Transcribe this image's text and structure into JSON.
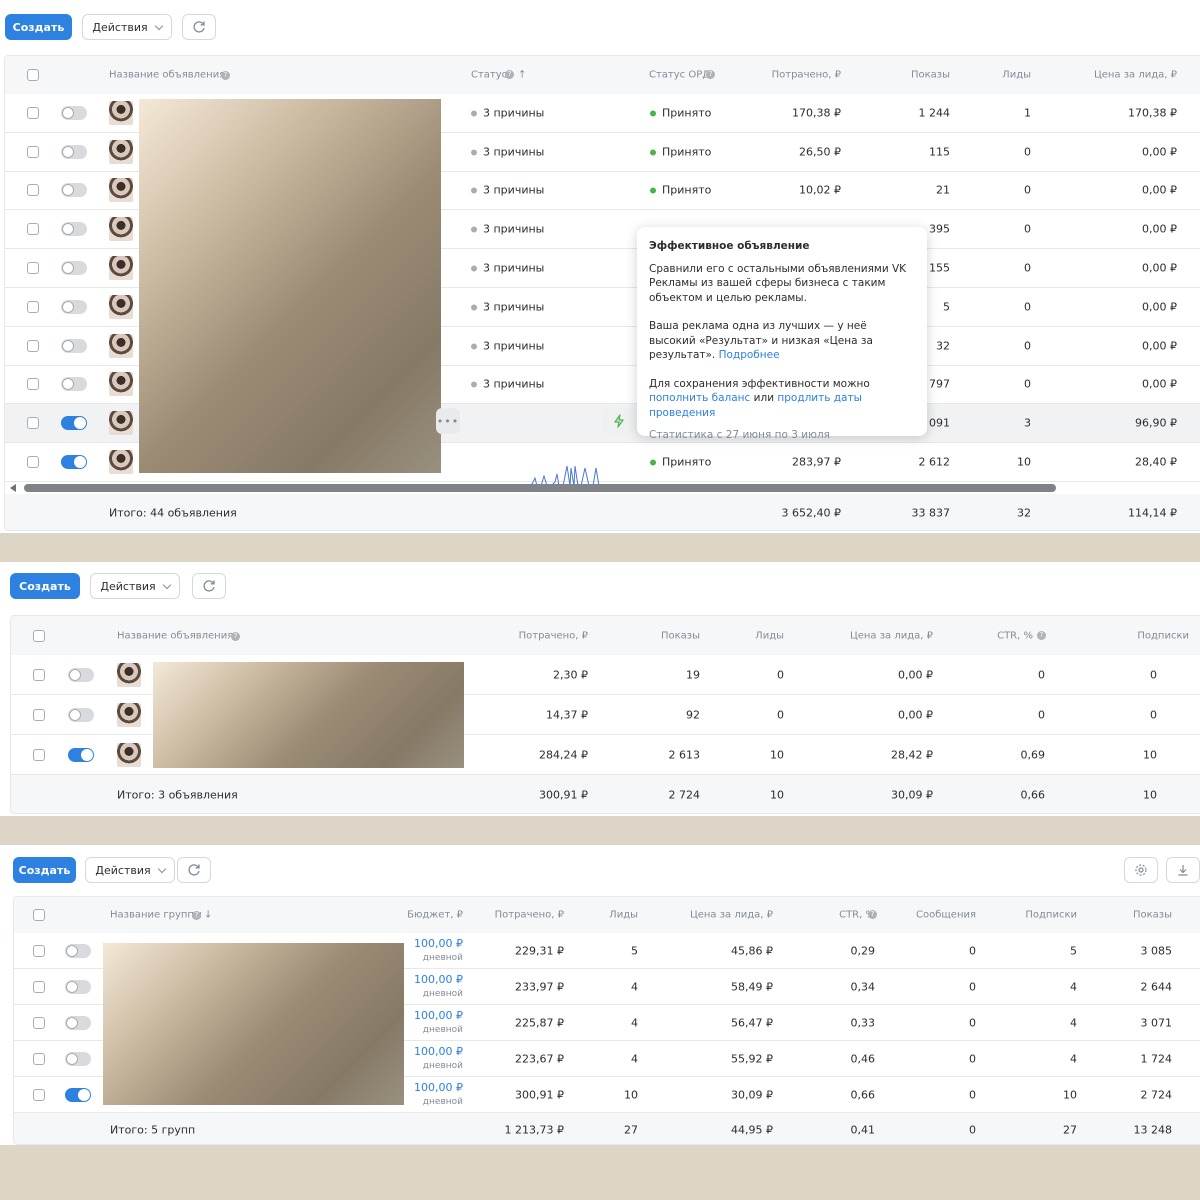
{
  "toolbar": {
    "create_label": "Создать",
    "actions_label": "Действия"
  },
  "panel1": {
    "headers": {
      "name": "Название объявления",
      "status": "Статус",
      "ord_status": "Статус ОРД",
      "spent": "Потрачено, ₽",
      "shows": "Показы",
      "leads": "Лиды",
      "lead_price": "Цена за лида, ₽"
    },
    "rows": [
      {
        "status": "3 причины",
        "ord": "Принято",
        "spent": "170,38 ₽",
        "shows": "1 244",
        "leads": "1",
        "price": "170,38 ₽",
        "on": false
      },
      {
        "status": "3 причины",
        "ord": "Принято",
        "spent": "26,50 ₽",
        "shows": "115",
        "leads": "0",
        "price": "0,00 ₽",
        "on": false
      },
      {
        "status": "3 причины",
        "ord": "Принято",
        "spent": "10,02 ₽",
        "shows": "21",
        "leads": "0",
        "price": "0,00 ₽",
        "on": false
      },
      {
        "status": "3 причины",
        "ord": "",
        "spent": "",
        "shows": "395",
        "leads": "0",
        "price": "0,00 ₽",
        "on": false
      },
      {
        "status": "3 причины",
        "ord": "",
        "spent": "",
        "shows": "155",
        "leads": "0",
        "price": "0,00 ₽",
        "on": false
      },
      {
        "status": "3 причины",
        "ord": "",
        "spent": "",
        "shows": "5",
        "leads": "0",
        "price": "0,00 ₽",
        "on": false
      },
      {
        "status": "3 причины",
        "ord": "",
        "spent": "",
        "shows": "32",
        "leads": "0",
        "price": "0,00 ₽",
        "on": false
      },
      {
        "status": "3 причины",
        "ord": "",
        "spent": "",
        "shows": "797",
        "leads": "0",
        "price": "0,00 ₽",
        "on": false
      },
      {
        "status": "",
        "ord": "",
        "spent": "",
        "shows": "2 091",
        "leads": "3",
        "price": "96,90 ₽",
        "on": true
      },
      {
        "status": "",
        "ord": "Принято",
        "spent": "283,97 ₽",
        "shows": "2 612",
        "leads": "10",
        "price": "28,40 ₽",
        "on": true
      }
    ],
    "footer": {
      "label": "Итого: 44 объявления",
      "spent": "3 652,40 ₽",
      "shows": "33 837",
      "leads": "32",
      "price": "114,14 ₽"
    },
    "tooltip": {
      "title": "Эффективное объявление",
      "p1": "Сравнили его с остальными объявлениями VK Рекламы из вашей сферы бизнеса с таким объектом и целью рекламы.",
      "p2": "Ваша реклама одна из лучших — у неё высокий «Результат» и низкая «Цена за результат».",
      "more": "Подробнее",
      "p3": "Для сохранения эффективности можно",
      "link1": "пополнить баланс",
      "or": "или",
      "link2": "продлить даты проведения",
      "stats": "Статистика с 27 июня по 3 июля"
    }
  },
  "panel2": {
    "headers": {
      "name": "Название объявления",
      "spent": "Потрачено, ₽",
      "shows": "Показы",
      "leads": "Лиды",
      "lead_price": "Цена за лида, ₽",
      "ctr": "CTR, %",
      "subs": "Подписки"
    },
    "rows": [
      {
        "spent": "2,30 ₽",
        "shows": "19",
        "leads": "0",
        "price": "0,00 ₽",
        "ctr": "0",
        "subs": "0",
        "on": false
      },
      {
        "spent": "14,37 ₽",
        "shows": "92",
        "leads": "0",
        "price": "0,00 ₽",
        "ctr": "0",
        "subs": "0",
        "on": false
      },
      {
        "spent": "284,24 ₽",
        "shows": "2 613",
        "leads": "10",
        "price": "28,42 ₽",
        "ctr": "0,69",
        "subs": "10",
        "on": true
      }
    ],
    "footer": {
      "label": "Итого: 3 объявления",
      "spent": "300,91 ₽",
      "shows": "2 724",
      "leads": "10",
      "price": "30,09 ₽",
      "ctr": "0,66",
      "subs": "10"
    }
  },
  "panel3": {
    "headers": {
      "name": "Название группы",
      "budget": "Бюджет, ₽",
      "spent": "Потрачено, ₽",
      "leads": "Лиды",
      "lead_price": "Цена за лида, ₽",
      "ctr": "CTR, %",
      "msgs": "Сообщения",
      "subs": "Подписки",
      "shows": "Показы"
    },
    "rows": [
      {
        "budget": "100,00 ₽",
        "budget_type": "дневной",
        "spent": "229,31 ₽",
        "leads": "5",
        "price": "45,86 ₽",
        "ctr": "0,29",
        "msgs": "0",
        "subs": "5",
        "shows": "3 085",
        "on": false
      },
      {
        "budget": "100,00 ₽",
        "budget_type": "дневной",
        "spent": "233,97 ₽",
        "leads": "4",
        "price": "58,49 ₽",
        "ctr": "0,34",
        "msgs": "0",
        "subs": "4",
        "shows": "2 644",
        "on": false
      },
      {
        "budget": "100,00 ₽",
        "budget_type": "дневной",
        "spent": "225,87 ₽",
        "leads": "4",
        "price": "56,47 ₽",
        "ctr": "0,33",
        "msgs": "0",
        "subs": "4",
        "shows": "3 071",
        "on": false
      },
      {
        "budget": "100,00 ₽",
        "budget_type": "дневной",
        "spent": "223,67 ₽",
        "leads": "4",
        "price": "55,92 ₽",
        "ctr": "0,46",
        "msgs": "0",
        "subs": "4",
        "shows": "1 724",
        "on": false
      },
      {
        "budget": "100,00 ₽",
        "budget_type": "дневной",
        "spent": "300,91 ₽",
        "leads": "10",
        "price": "30,09 ₽",
        "ctr": "0,66",
        "msgs": "0",
        "subs": "10",
        "shows": "2 724",
        "on": true
      }
    ],
    "footer": {
      "label": "Итого: 5 групп",
      "spent": "1 213,73 ₽",
      "leads": "27",
      "price": "44,95 ₽",
      "ctr": "0,41",
      "msgs": "0",
      "subs": "27",
      "shows": "13 248"
    }
  },
  "colors": {
    "accent": "#2d81e0",
    "success": "#4bb34b",
    "muted": "#818c99"
  }
}
